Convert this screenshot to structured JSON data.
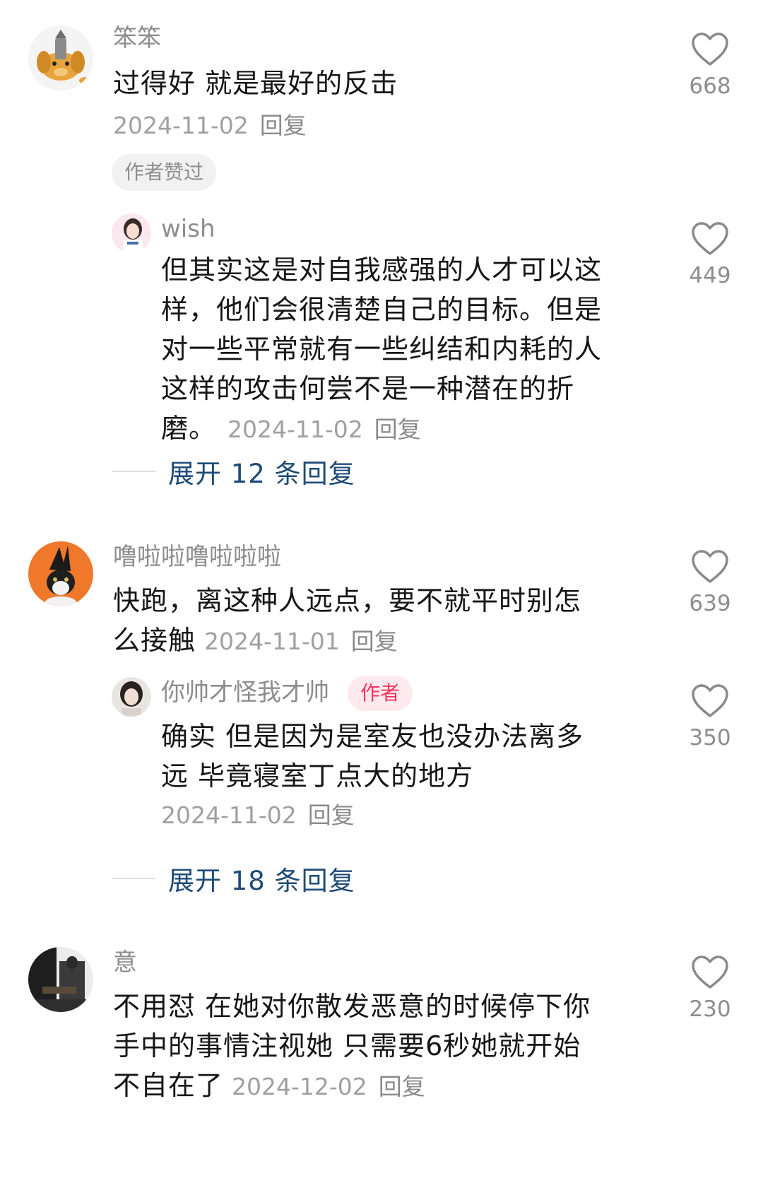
{
  "comments": [
    {
      "username": "笨笨",
      "text": "过得好 就是最好的反击",
      "date": "2024-11-02",
      "reply": "回复",
      "likes": "668",
      "badge": "作者赞过",
      "avatar_icon": "cartoon-dog-avatar"
    },
    {
      "username": "wish",
      "text": "但其实这是对自我感强的人才可以这样，他们会很清楚自己的目标。但是对一些平常就有一些纠结和内耗的人这样的攻击何尝不是一种潜在的折磨。",
      "date": "2024-11-02",
      "reply": "回复",
      "likes": "449",
      "avatar_icon": "girl-photo-avatar"
    },
    {
      "expand": "展开 12 条回复"
    },
    {
      "username": "噜啦啦噜啦啦啦",
      "text": "快跑，离这种人远点，要不就平时别怎么接触",
      "date": "2024-11-01",
      "reply": "回复",
      "likes": "639",
      "avatar_icon": "cat-orange-avatar"
    },
    {
      "username": "你帅才怪我才帅",
      "author_badge": "作者",
      "text": "确实 但是因为是室友也没办法离多远 毕竟寝室丁点大的地方",
      "date": "2024-11-02",
      "reply": "回复",
      "likes": "350",
      "avatar_icon": "girl-portrait-avatar"
    },
    {
      "expand": "展开 18 条回复"
    },
    {
      "username": "意",
      "text": "不用怼 在她对你散发恶意的时候停下你手中的事情注视她 只需要6秒她就开始不自在了",
      "date": "2024-12-02",
      "reply": "回复",
      "likes": "230",
      "avatar_icon": "dark-photo-avatar"
    }
  ],
  "colors": {
    "link": "#1e4a78",
    "author_badge_text": "#f5345b",
    "author_badge_bg": "#fde9ee",
    "muted": "#8d8d8d"
  }
}
